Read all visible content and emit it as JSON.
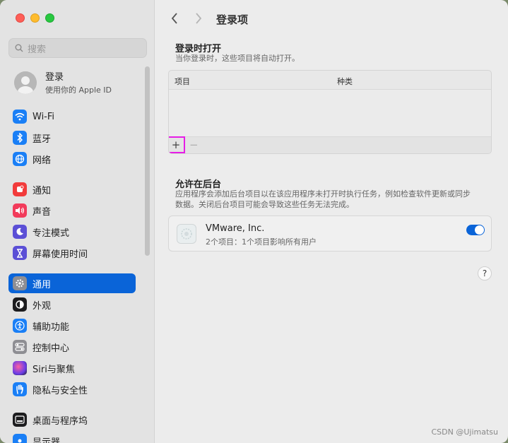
{
  "sidebar": {
    "search_placeholder": "搜索",
    "account": {
      "title": "登录",
      "subtitle": "使用你的 Apple ID"
    },
    "items": [
      {
        "label": "Wi-Fi",
        "icon": "wifi-icon",
        "color": "#1a7ff6"
      },
      {
        "label": "蓝牙",
        "icon": "bluetooth-icon",
        "color": "#1a7ff6"
      },
      {
        "label": "网络",
        "icon": "globe-icon",
        "color": "#1a7ff6"
      },
      {
        "label": "通知",
        "icon": "bell-icon",
        "color": "#f23b3b"
      },
      {
        "label": "声音",
        "icon": "speaker-icon",
        "color": "#f23b5b"
      },
      {
        "label": "专注模式",
        "icon": "moon-icon",
        "color": "#5b4fd6"
      },
      {
        "label": "屏幕使用时间",
        "icon": "hourglass-icon",
        "color": "#5b4fd6"
      },
      {
        "label": "通用",
        "icon": "gear-icon",
        "color": "#8e8e93",
        "active": true
      },
      {
        "label": "外观",
        "icon": "appearance-icon",
        "color": "#1c1c1e"
      },
      {
        "label": "辅助功能",
        "icon": "accessibility-icon",
        "color": "#1a7ff6"
      },
      {
        "label": "控制中心",
        "icon": "control-center-icon",
        "color": "#8e8e93"
      },
      {
        "label": "Siri与聚焦",
        "icon": "siri-icon",
        "color": "#6a3de8"
      },
      {
        "label": "隐私与安全性",
        "icon": "hand-icon",
        "color": "#1a7ff6"
      },
      {
        "label": "桌面与程序坞",
        "icon": "dock-icon",
        "color": "#1c1c1e"
      },
      {
        "label": "显示器",
        "icon": "display-icon",
        "color": "#1a7ff6"
      }
    ]
  },
  "header": {
    "title": "登录项"
  },
  "login_section": {
    "title": "登录时打开",
    "desc": "当你登录时，这些项目将自动打开。",
    "col_item": "项目",
    "col_kind": "种类",
    "add_label": "+",
    "remove_label": "−"
  },
  "background_section": {
    "title": "允许在后台",
    "desc_line1": "应用程序会添加后台项目以在该应用程序未打开时执行任务，例如检查软件更新或同步",
    "desc_line2": "数据。关闭后台项目可能会导致这些任务无法完成。",
    "app": {
      "name": "VMware, Inc.",
      "sub": "2个项目：1个项目影响所有用户",
      "enabled": true
    }
  },
  "help_label": "?",
  "watermark": "CSDN @Ujimatsu"
}
